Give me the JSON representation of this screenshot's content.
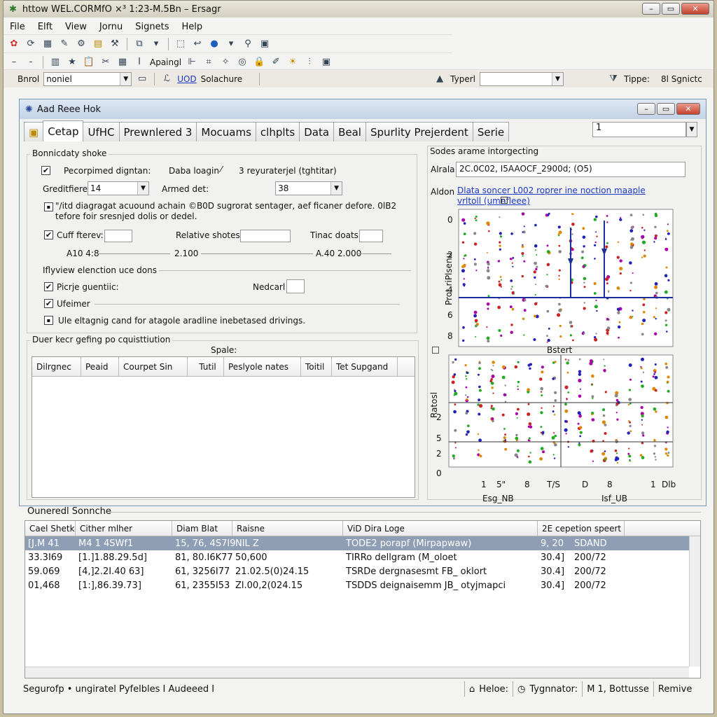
{
  "window": {
    "title": "httow WEL.CORMfO ×³ 1:23-M.5Bn – Ersagr"
  },
  "menu": [
    "File",
    "Elft",
    "View",
    "Jornu",
    "Signets",
    "Help"
  ],
  "toolbar2": {
    "label": "Apaingl"
  },
  "toolbar3": {
    "left_label": "Bnrol",
    "combo_value": "noniel",
    "link_label": "UOD",
    "doc_label": "Solachure",
    "typer_label": "Typerl",
    "tippe_label": "Tippe:",
    "sgnetc_label": "8l Sgnictc"
  },
  "child": {
    "title": "Aad Reee Hok",
    "tabs": [
      "Cetap",
      "UfHC",
      "Prewnlered 3",
      "Mocuams",
      "clhplts",
      "Data",
      "Beal",
      "Spurlity Prejerdent",
      "Serie"
    ],
    "spin_value": "1"
  },
  "left_group": {
    "title": "Bonnicdaty shoke",
    "check1": "Pecorpimed digntan:",
    "data_loagin": "Daba loagin",
    "regulated": "3 reyuraterjel (tghtitar)",
    "greditiere_label": "Greditfiere",
    "greditiere_value": "14",
    "armed_label": "Armed det:",
    "armed_value": "38",
    "note": "\"/itd diagragat acuound achain ©B0D sugrorat sentager, aef ficaner defore. 0lB2 tefore foir sresnjed dolis or dedel.",
    "cuff_label": "Cuff fterev:",
    "relative_label": "Relative shotes:",
    "tinac_label": "Tinac doats",
    "scale": [
      "A10 4:8",
      "2.100",
      "A.40 2.000"
    ],
    "section": "Iflyview elenction uce dons",
    "picrje": "Picrje guentiic:",
    "nedcarl": "Nedcarl",
    "ufeimer": "Ufeimer",
    "use_line": "Ule eltagnig cand for atagole aradline inebetased drivings."
  },
  "lower_group": {
    "title": "Duer kecr gefing po cquisttiution",
    "spec": "Spale:",
    "columns": [
      "Dilrgnec",
      "Peaid",
      "Courpet Sin",
      "Tutil",
      "Peslyole nates",
      "Toitil",
      "Tet Supgand"
    ]
  },
  "right_group": {
    "title": "Sodes arame intorgecting",
    "alrala_label": "Alrala",
    "alrala_value": "2C.0C02, I5AAOCF_2900d; (O5)",
    "aldon_label": "Aldon",
    "aldon_link": "Dlata soncer L002 roprer ine noction maaple vrltoll (umnfleee)",
    "y_label": "Prot riPlsenu",
    "y2_label": "Ratosl",
    "bstert": "Bstert",
    "y_ticks_top": [
      "0",
      "2",
      "4",
      "6",
      "8"
    ],
    "y_ticks_bottom": [
      "2",
      "5",
      "2",
      "0"
    ],
    "x_ticks": [
      "1",
      "5\"",
      "8",
      "T/S",
      "D",
      "8",
      "1",
      "Dlb"
    ],
    "x_labels": [
      "Esg_NB",
      "Isf_UB"
    ]
  },
  "bottom": {
    "title": "Ouneredl Sonnche",
    "columns": [
      "Cael Shetk",
      "Cither mlher",
      "Diam Blat",
      "Raisne",
      "ViD Dira Loge",
      "2E cepetion speert"
    ],
    "rows": [
      [
        "[J.M 41",
        "M4 1 4SWf1",
        "15, 76, 4S7I9",
        "NIL Z",
        "TODE2 porapf (Mirpapwaw)",
        "9, 20",
        "SDAND"
      ],
      [
        "33.3I69",
        "[1.]1.88.29.5d]",
        "81, 80.I6K77",
        "50,600",
        "TIRRo dellgram (M_oloet",
        "30.4]",
        "200/72"
      ],
      [
        "59.069",
        "[4,]2.2I.40 63]",
        "61, 3256I77",
        "21.02.5(0)24.15",
        "TSRDe dergnasesmt FB_ oklort",
        "30.4]",
        "200/72"
      ],
      [
        "01,468",
        "[1:],86.39.73]",
        "61, 2355I53",
        "Zl.00,2(024.15",
        "TSDDS deignaisemm JB_ otyjmapci",
        "30.4]",
        "200/72"
      ]
    ]
  },
  "status": {
    "left": "Segurofp • ungiratel Pyfelbles I Audeeed I",
    "helo": "Heloe:",
    "tyg": "Tygnnator:",
    "m1": "M 1, Bottusse",
    "remive": "Remive"
  }
}
